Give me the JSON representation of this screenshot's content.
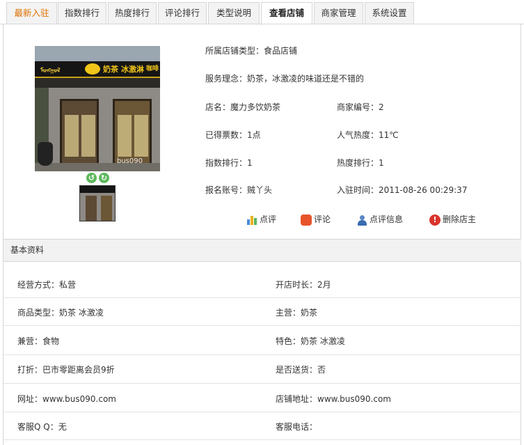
{
  "tabs": [
    {
      "label": "最新入驻"
    },
    {
      "label": "指数排行"
    },
    {
      "label": "热度排行"
    },
    {
      "label": "评论排行"
    },
    {
      "label": "类型说明"
    },
    {
      "label": "查看店铺"
    },
    {
      "label": "商家管理"
    },
    {
      "label": "系统设置"
    }
  ],
  "photo": {
    "sign_text_1": "奶茶",
    "sign_text_2": "冰激淋",
    "sign_text_3": "咖啡",
    "watermark": "bus090"
  },
  "info": {
    "shop_type": "所属店铺类型：食品店铺",
    "service": "服务理念：奶茶，冰激凌的味道还是不错的",
    "name": "店名：魔力多饮奶茶",
    "merchant_no": "商家编号：2",
    "votes": "已得票数：1点",
    "popularity": "人气热度：11℃",
    "index_rank": "指数排行：1",
    "heat_rank": "热度排行：1",
    "account": "报名账号：贼丫头",
    "join_time": "入驻时间：2011-08-26 00:29:37"
  },
  "actions": {
    "rate": "点评",
    "comment": "评论",
    "rate_info": "点评信息",
    "delete_owner": "删除店主"
  },
  "section_title": "基本资料",
  "details": {
    "mode": "经营方式：私营",
    "open_duration": "开店时长：2月",
    "goods_type": "商品类型：奶茶 冰激凌",
    "main": "主营：奶茶",
    "side": "兼营：食物",
    "feature": "特色：奶茶 冰激凌",
    "discount": "打折：巴市零距离会员9折",
    "delivery": "是否送货：否",
    "website": "网址：www.bus090.com",
    "address": "店铺地址：www.bus090.com",
    "qq": "客服Q Q：无",
    "phone": "客服电话："
  },
  "colors": {
    "active_tab_text": "#e07000",
    "section_bg": "#f2f2f2",
    "border": "#d6d6d6"
  }
}
